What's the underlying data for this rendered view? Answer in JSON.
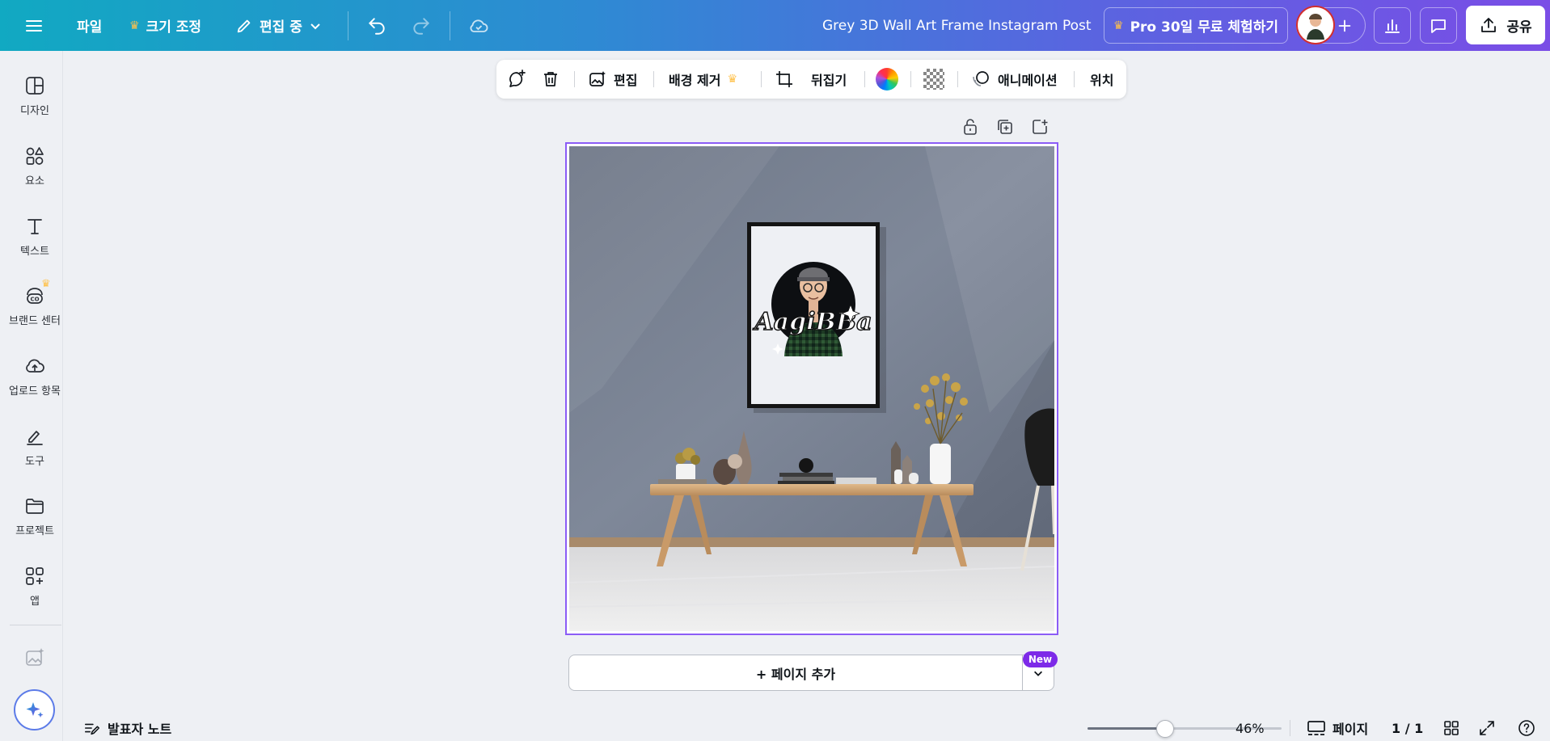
{
  "topbar": {
    "file_label": "파일",
    "resize_label": "크기 조정",
    "editing_label": "편집 중",
    "design_title": "Grey 3D Wall Art Frame Instagram Post",
    "pro_trial_label": "Pro 30일 무료 체험하기",
    "share_label": "공유"
  },
  "sidebar": {
    "items": [
      {
        "label": "디자인",
        "icon": "design-icon"
      },
      {
        "label": "요소",
        "icon": "elements-icon"
      },
      {
        "label": "텍스트",
        "icon": "text-icon"
      },
      {
        "label": "브랜드 센터",
        "icon": "brand-icon"
      },
      {
        "label": "업로드 항목",
        "icon": "upload-icon"
      },
      {
        "label": "도구",
        "icon": "draw-icon"
      },
      {
        "label": "프로젝트",
        "icon": "folder-icon"
      },
      {
        "label": "앱",
        "icon": "apps-icon"
      }
    ]
  },
  "context_toolbar": {
    "edit_label": "편집",
    "bg_remove_label": "배경 제거",
    "flip_label": "뒤집기",
    "animate_label": "애니메이션",
    "position_label": "위치"
  },
  "canvas": {
    "logo_text": "AagiBBa"
  },
  "add_page": {
    "label": "+ 페이지 추가",
    "badge": "New"
  },
  "bottom": {
    "notes_label": "발표자 노트",
    "zoom": "46%",
    "zoom_fraction": 0.4,
    "pages_label": "페이지",
    "page_count": "1 / 1"
  },
  "colors": {
    "accent_purple": "#8b5cf6",
    "new_badge": "#7d2ae8",
    "crown": "#ffc14a"
  }
}
